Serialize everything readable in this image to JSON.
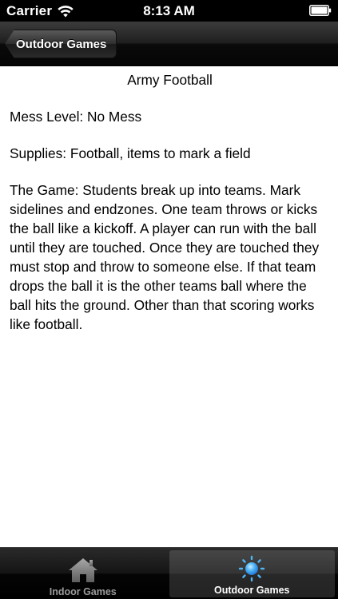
{
  "status_bar": {
    "carrier": "Carrier",
    "time": "8:13 AM",
    "wifi_icon": "wifi-icon",
    "battery_icon": "battery-icon"
  },
  "nav": {
    "back_label": "Outdoor Games"
  },
  "content": {
    "title": "Army Football",
    "mess_level": "Mess Level: No Mess",
    "supplies": "Supplies: Football, items to mark a field",
    "game": "The Game: Students break up into teams. Mark sidelines and endzones. One team throws or kicks the ball like a kickoff. A player can run with the ball until they are touched. Once they are touched they must stop and throw to someone else. If that team drops the ball it is the other teams ball where the ball hits the ground.  Other than that scoring works like football."
  },
  "tab_bar": {
    "tabs": [
      {
        "label": "Indoor Games",
        "icon": "house-icon",
        "selected": false
      },
      {
        "label": "Outdoor Games",
        "icon": "sun-icon",
        "selected": true
      }
    ]
  },
  "colors": {
    "tab_selected_label": "#ffffff",
    "tab_label": "#9b9b9b",
    "sun_icon": "#3fa9f5"
  }
}
